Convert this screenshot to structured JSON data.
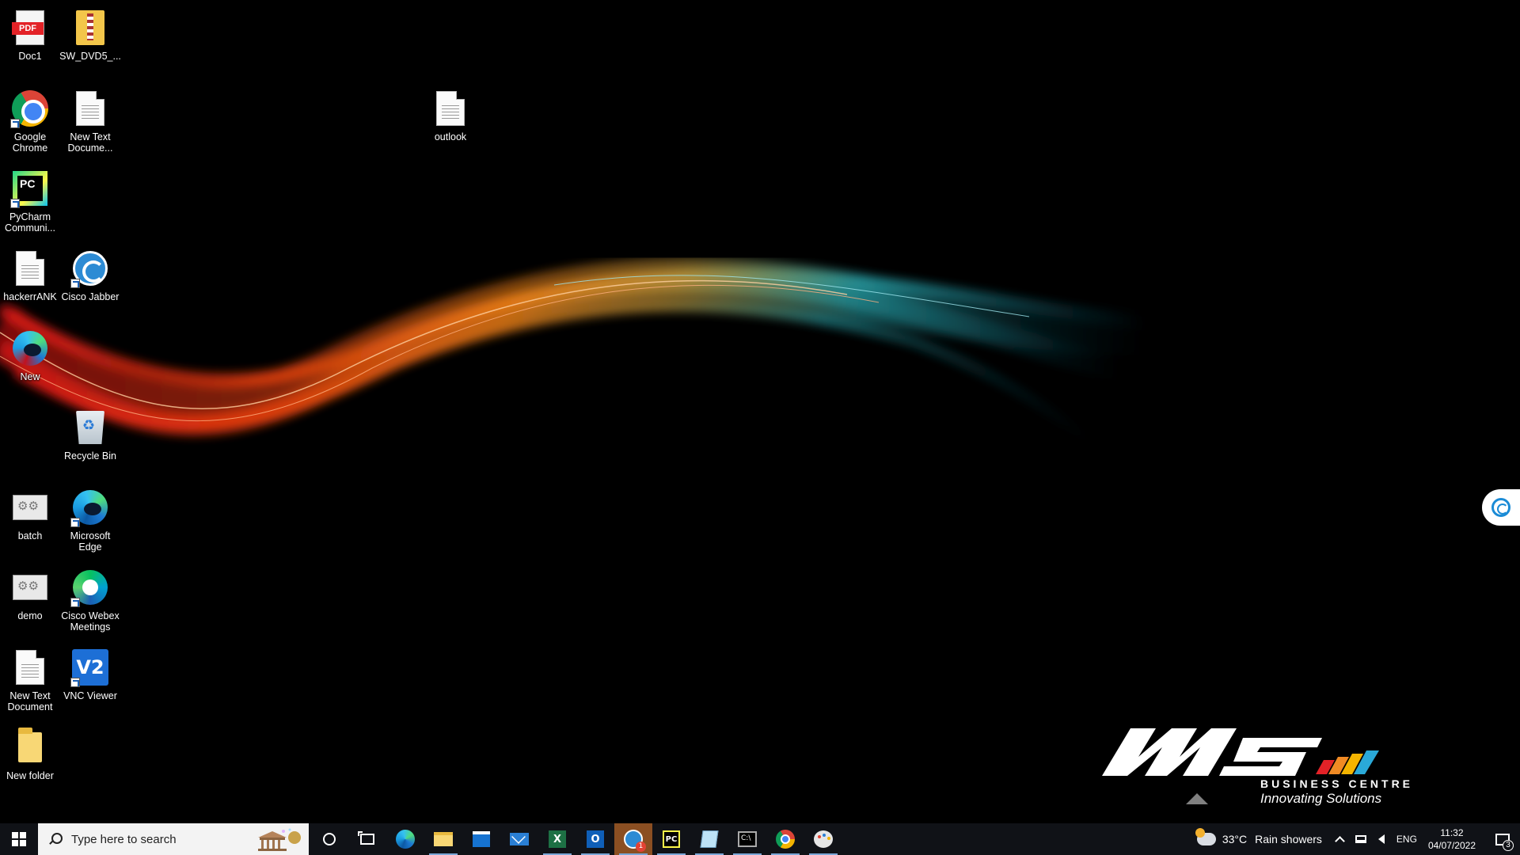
{
  "desktop": {
    "icons": [
      {
        "label": "Doc1",
        "icon": "pdf-file-icon"
      },
      {
        "label": "SW_DVD5_...",
        "icon": "zip-folder-icon"
      },
      {
        "label": "Google Chrome",
        "icon": "chrome-icon"
      },
      {
        "label": "New Text Docume...",
        "icon": "text-file-icon"
      },
      {
        "label": "outlook",
        "icon": "text-file-icon"
      },
      {
        "label": "PyCharm Communi...",
        "icon": "pycharm-icon"
      },
      {
        "label": "hackerrANK",
        "icon": "text-file-icon"
      },
      {
        "label": "Cisco Jabber",
        "icon": "jabber-icon"
      },
      {
        "label": "New",
        "icon": "edge-icon"
      },
      {
        "label": "Recycle Bin",
        "icon": "recycle-bin-icon"
      },
      {
        "label": "batch",
        "icon": "batch-file-icon"
      },
      {
        "label": "Microsoft Edge",
        "icon": "edge-icon"
      },
      {
        "label": "demo",
        "icon": "batch-file-icon"
      },
      {
        "label": "Cisco Webex Meetings",
        "icon": "webex-icon"
      },
      {
        "label": "New Text Document",
        "icon": "text-file-icon"
      },
      {
        "label": "VNC Viewer",
        "icon": "vnc-icon"
      },
      {
        "label": "New folder",
        "icon": "folder-icon"
      }
    ],
    "pdf_tag": "PDF",
    "pycharm_badge": "PC",
    "vnc_badge": "V2",
    "logo": {
      "line1": "BUSINESS CENTRE",
      "line2": "Innovating Solutions"
    }
  },
  "taskbar": {
    "search_placeholder": "Type here to search",
    "apps": [
      {
        "name": "Microsoft Edge",
        "icon": "edge-icon"
      },
      {
        "name": "File Explorer",
        "icon": "folder-icon"
      },
      {
        "name": "Microsoft Store",
        "icon": "store-icon"
      },
      {
        "name": "Mail",
        "icon": "mail-icon"
      },
      {
        "name": "Excel",
        "icon": "excel-icon",
        "badge": "X"
      },
      {
        "name": "Outlook",
        "icon": "outlook-icon",
        "badge": "O"
      },
      {
        "name": "Cisco Jabber",
        "icon": "jabber-icon",
        "notification": "1"
      },
      {
        "name": "PyCharm",
        "icon": "pycharm-icon",
        "badge": "PC"
      },
      {
        "name": "Notepad",
        "icon": "notepad-icon"
      },
      {
        "name": "Command Prompt",
        "icon": "cmd-icon",
        "badge": "C:\\"
      },
      {
        "name": "Google Chrome",
        "icon": "chrome-icon"
      },
      {
        "name": "Paint",
        "icon": "paint-icon"
      }
    ],
    "tray": {
      "temperature": "33°C",
      "weather": "Rain showers",
      "language": "ENG",
      "time": "11:32",
      "date": "04/07/2022",
      "notification_count": "3"
    }
  }
}
